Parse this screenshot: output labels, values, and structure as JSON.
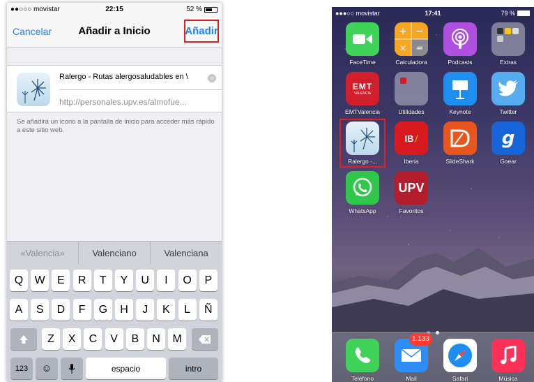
{
  "left": {
    "status": {
      "carrier": "●●○○○ movistar",
      "time": "22:15",
      "battery": "52 %"
    },
    "nav": {
      "cancel": "Cancelar",
      "title": "Añadir a Inicio",
      "add": "Añadir"
    },
    "site": {
      "name": "Ralergo - Rutas alergosaludables en \\",
      "url": "http://personales.upv.es/almofue..."
    },
    "description": "Se añadirá un icono a la pantalla de inicio para acceder más rápido a este sitio web.",
    "suggestions": [
      "«Valencia»",
      "Valenciano",
      "Valenciana"
    ],
    "keyboard": {
      "row1": [
        "Q",
        "W",
        "E",
        "R",
        "T",
        "Y",
        "U",
        "I",
        "O",
        "P"
      ],
      "row2": [
        "A",
        "S",
        "D",
        "F",
        "G",
        "H",
        "J",
        "K",
        "L",
        "Ñ"
      ],
      "row3": [
        "Z",
        "X",
        "C",
        "V",
        "B",
        "N",
        "M"
      ],
      "numbers": "123",
      "space": "espacio",
      "return": "intro"
    }
  },
  "right": {
    "status": {
      "carrier": "●●●○○ movistar",
      "time": "17:41",
      "battery": "79 %"
    },
    "apps": [
      {
        "label": "FaceTime",
        "color": "#3fd35a"
      },
      {
        "label": "Calculadora",
        "color": "#f5a623"
      },
      {
        "label": "Podcasts",
        "color": "#b050e0"
      },
      {
        "label": "Extras",
        "color": "#8a8a99"
      },
      {
        "label": "EMTValencia",
        "color": "#d01e2a"
      },
      {
        "label": "Utilidades",
        "color": "#8a8a99"
      },
      {
        "label": "Keynote",
        "color": "#1f8ef1"
      },
      {
        "label": "Twitter",
        "color": "#55acee"
      },
      {
        "label": "Ralergo -...",
        "color": "#cfe4f1"
      },
      {
        "label": "Iberia",
        "color": "#d71920"
      },
      {
        "label": "SlideShark",
        "color": "#e8561e"
      },
      {
        "label": "Goear",
        "color": "#1565d8"
      },
      {
        "label": "WhatsApp",
        "color": "#2fc84a"
      },
      {
        "label": "Favoritos",
        "color": "#b41e2c"
      }
    ],
    "dock": [
      {
        "label": "Teléfono",
        "color": "#3fd35a"
      },
      {
        "label": "Mail",
        "color": "#2f8df6",
        "badge": "1.133"
      },
      {
        "label": "Safari",
        "color": "#ffffff"
      },
      {
        "label": "Música",
        "color": "#fc3158"
      }
    ],
    "icon_text": {
      "emt": "EMT",
      "emt_sub": "VALENCIA",
      "iberia": "IB",
      "upv": "UPV",
      "goear": "g"
    }
  }
}
